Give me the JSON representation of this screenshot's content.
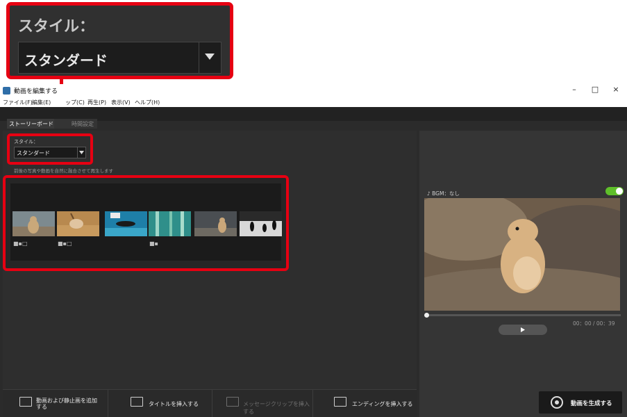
{
  "callout": {
    "style_label": "スタイル：",
    "style_value": "スタンダード"
  },
  "window": {
    "title": "動画を編集する",
    "controls": [
      "–",
      "□",
      "×"
    ]
  },
  "menu": [
    "ファイル(F)",
    "編集(E)",
    "ップ(C)",
    "再生(P)",
    "表示(V)",
    "ヘルプ(H)"
  ],
  "tabs": [
    "ストーリーボード",
    "時間設定"
  ],
  "style": {
    "label": "スタイル：",
    "value": "スタンダード"
  },
  "description": "前後の写真や動画を自然に融合させて再生します",
  "storyboard": {
    "thumbnails": [
      {
        "subject": "prairie dog",
        "has_camera_icon": true,
        "has_memo_icon": true
      },
      {
        "subject": "ibex",
        "has_camera_icon": true,
        "has_memo_icon": true
      },
      {
        "subject": "sea lion",
        "has_camera_icon": false,
        "has_memo_icon": false
      },
      {
        "subject": "aquarium",
        "has_camera_icon": true,
        "has_memo_icon": false
      },
      {
        "subject": "prairie dog",
        "has_camera_icon": false,
        "has_memo_icon": false
      },
      {
        "subject": "penguins",
        "has_camera_icon": false,
        "has_memo_icon": false
      }
    ]
  },
  "bottom_buttons": {
    "add_media": "動画および静止画を追加する",
    "insert_title": "タイトルを挿入する",
    "insert_message": "メッセージクリップを挿入する",
    "insert_ending": "エンディングを挿入する"
  },
  "preview": {
    "bgm_label": "BGM：なし",
    "timecode": "00：00 / 00：39"
  },
  "generate_button": "動画を生成する",
  "colors": {
    "highlight": "#e60012",
    "toggle_on": "#5fbf2a"
  }
}
